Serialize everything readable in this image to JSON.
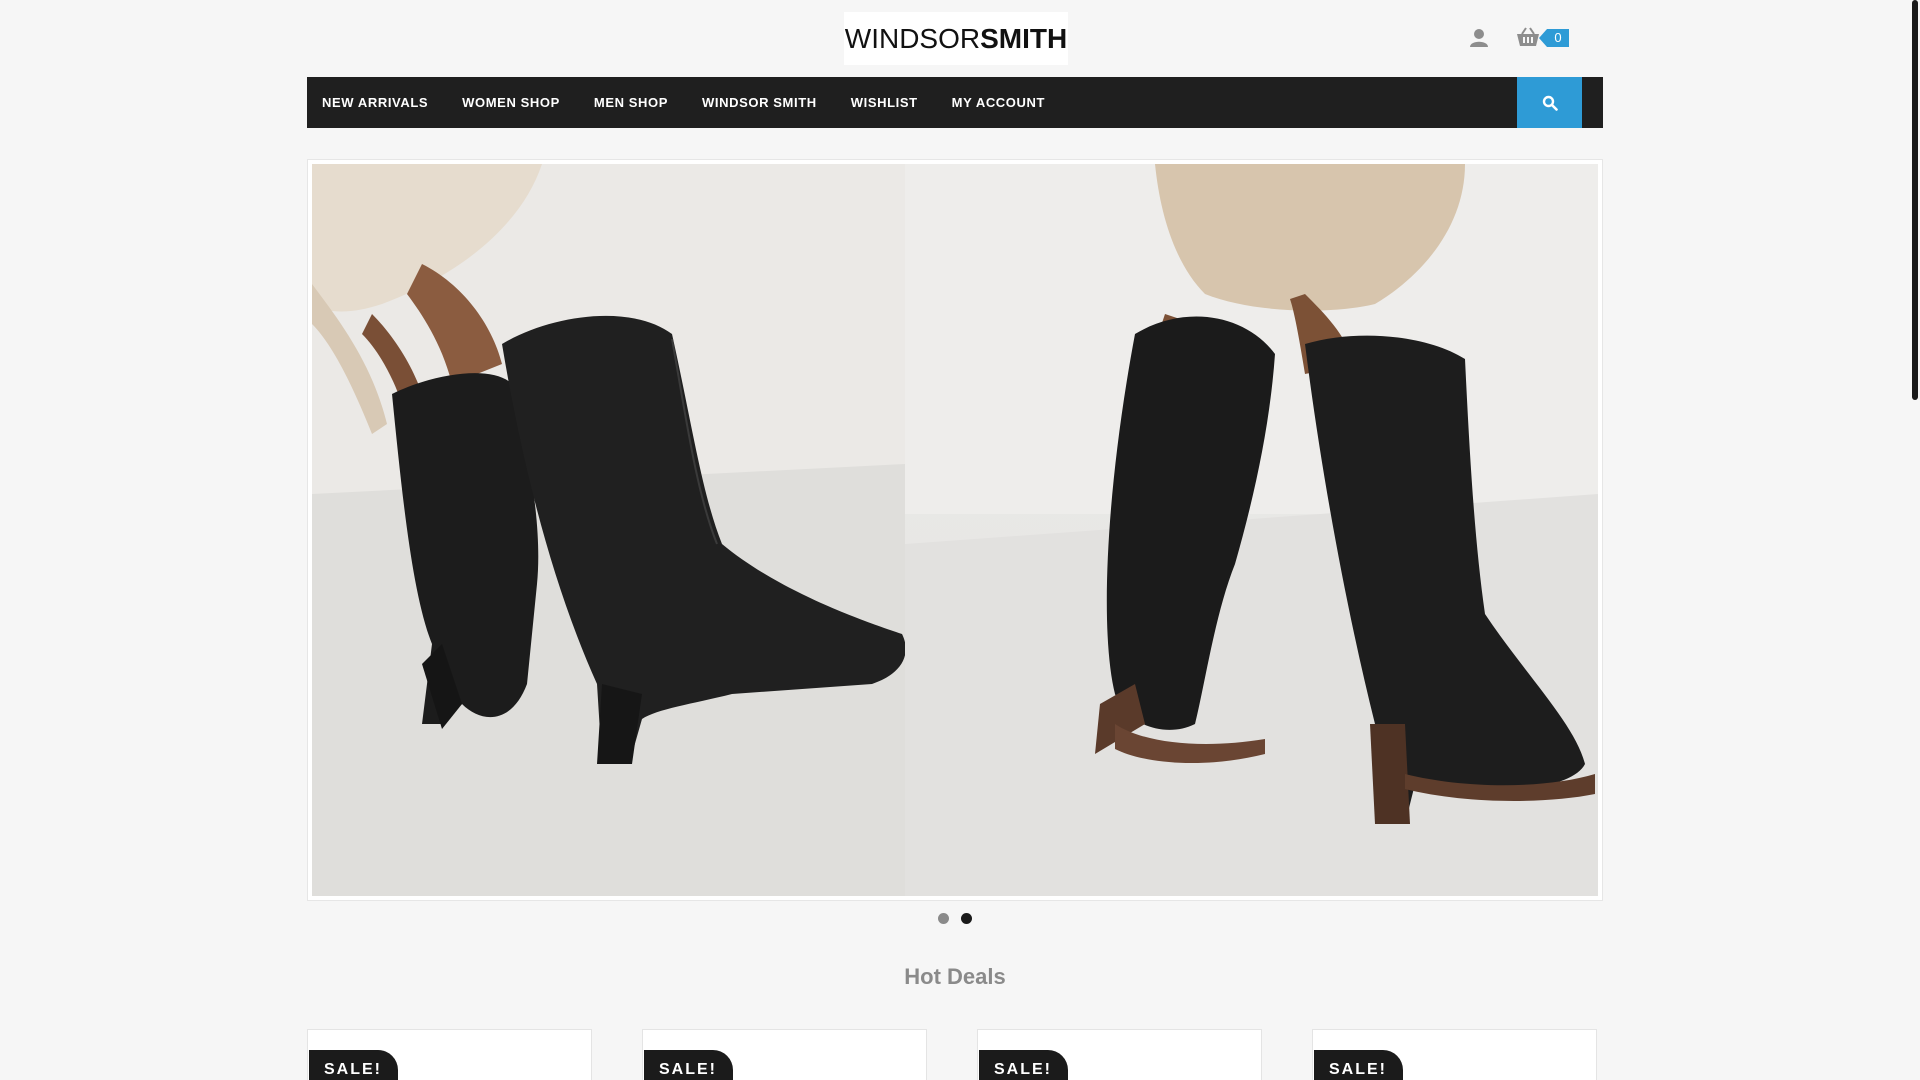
{
  "header": {
    "logo_thin": "WINDSOR",
    "logo_bold": "SMITH",
    "user_icon": "user-icon",
    "cart_icon": "basket-icon",
    "cart_count": "0"
  },
  "nav": {
    "items": [
      {
        "label": "NEW ARRIVALS"
      },
      {
        "label": "WOMEN SHOP"
      },
      {
        "label": "MEN SHOP"
      },
      {
        "label": "WINDSOR SMITH"
      },
      {
        "label": "WISHLIST"
      },
      {
        "label": "MY ACCOUNT"
      }
    ],
    "search_icon": "search-icon"
  },
  "slider": {
    "slide_count": 2,
    "active_index": 2
  },
  "hot_deals": {
    "title": "Hot Deals",
    "products": [
      {
        "badge": "SALE!"
      },
      {
        "badge": "SALE!"
      },
      {
        "badge": "SALE!"
      },
      {
        "badge": "SALE!"
      }
    ]
  },
  "colors": {
    "accent": "#2e9bd6",
    "nav_bg": "#1f1f1f",
    "page_bg": "#f6f6f6"
  }
}
